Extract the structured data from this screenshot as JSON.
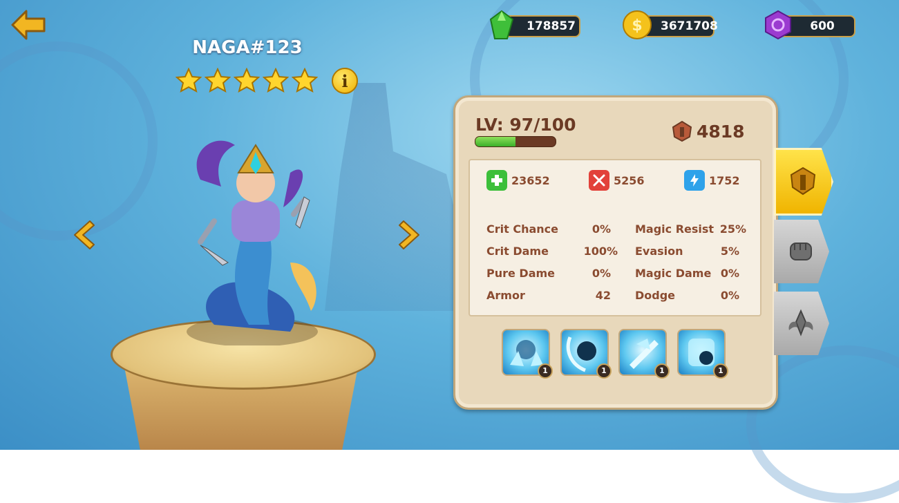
{
  "currencies": [
    {
      "name": "gem-green",
      "value": "178857",
      "color": "#3fbf3a"
    },
    {
      "name": "gold-coin",
      "value": "3671708",
      "color": "#f4c21c"
    },
    {
      "name": "purple-crystal",
      "value": "600",
      "color": "#9b3bd0"
    }
  ],
  "hero": {
    "name": "NAGA#123",
    "stars": 5,
    "info_glyph": "i"
  },
  "panel": {
    "level_text": "LV: 97/100",
    "level_progress": 0.5,
    "power": "4818",
    "main_stats": {
      "hp": "23652",
      "attack": "5256",
      "speed": "1752"
    },
    "stats": [
      {
        "label": "Crit Chance",
        "value": "0%"
      },
      {
        "label": "Magic Resist",
        "value": "25%"
      },
      {
        "label": "Crit Dame",
        "value": "100%"
      },
      {
        "label": "Evasion",
        "value": "5%"
      },
      {
        "label": "Pure Dame",
        "value": "0%"
      },
      {
        "label": "Magic Dame",
        "value": "0%"
      },
      {
        "label": "Armor",
        "value": "42"
      },
      {
        "label": "Dodge",
        "value": "0%"
      }
    ],
    "skills": [
      {
        "icon": "ice-golem-skill-icon",
        "level": "1"
      },
      {
        "icon": "shadow-slash-skill-icon",
        "level": "1"
      },
      {
        "icon": "ice-shard-skill-icon",
        "level": "1"
      },
      {
        "icon": "frost-orb-skill-icon",
        "level": "1"
      }
    ]
  },
  "side_tabs": [
    {
      "icon": "helmet-icon",
      "active": true
    },
    {
      "icon": "fist-icon",
      "active": false
    },
    {
      "icon": "wings-emblem-icon",
      "active": false
    }
  ]
}
